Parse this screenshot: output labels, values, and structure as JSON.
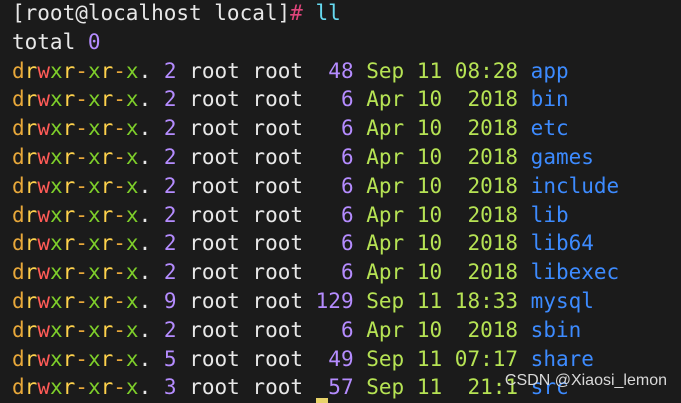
{
  "prompt": {
    "user_host": "[root@localhost local]",
    "symbol": "#",
    "command": "ll"
  },
  "total_line": "total 0",
  "entries": [
    {
      "perms": "drwxr-xr-x.",
      "links": "2",
      "owner": "root",
      "group": "root",
      "size": "48",
      "month": "Sep",
      "day": "11",
      "time": "08:28",
      "name": "app"
    },
    {
      "perms": "drwxr-xr-x.",
      "links": "2",
      "owner": "root",
      "group": "root",
      "size": "6",
      "month": "Apr",
      "day": "10",
      "time": "2018",
      "name": "bin"
    },
    {
      "perms": "drwxr-xr-x.",
      "links": "2",
      "owner": "root",
      "group": "root",
      "size": "6",
      "month": "Apr",
      "day": "10",
      "time": "2018",
      "name": "etc"
    },
    {
      "perms": "drwxr-xr-x.",
      "links": "2",
      "owner": "root",
      "group": "root",
      "size": "6",
      "month": "Apr",
      "day": "10",
      "time": "2018",
      "name": "games"
    },
    {
      "perms": "drwxr-xr-x.",
      "links": "2",
      "owner": "root",
      "group": "root",
      "size": "6",
      "month": "Apr",
      "day": "10",
      "time": "2018",
      "name": "include"
    },
    {
      "perms": "drwxr-xr-x.",
      "links": "2",
      "owner": "root",
      "group": "root",
      "size": "6",
      "month": "Apr",
      "day": "10",
      "time": "2018",
      "name": "lib"
    },
    {
      "perms": "drwxr-xr-x.",
      "links": "2",
      "owner": "root",
      "group": "root",
      "size": "6",
      "month": "Apr",
      "day": "10",
      "time": "2018",
      "name": "lib64"
    },
    {
      "perms": "drwxr-xr-x.",
      "links": "2",
      "owner": "root",
      "group": "root",
      "size": "6",
      "month": "Apr",
      "day": "10",
      "time": "2018",
      "name": "libexec"
    },
    {
      "perms": "drwxr-xr-x.",
      "links": "9",
      "owner": "root",
      "group": "root",
      "size": "129",
      "month": "Sep",
      "day": "11",
      "time": "18:33",
      "name": "mysql"
    },
    {
      "perms": "drwxr-xr-x.",
      "links": "2",
      "owner": "root",
      "group": "root",
      "size": "6",
      "month": "Apr",
      "day": "10",
      "time": "2018",
      "name": "sbin"
    },
    {
      "perms": "drwxr-xr-x.",
      "links": "5",
      "owner": "root",
      "group": "root",
      "size": "49",
      "month": "Sep",
      "day": "11",
      "time": "07:17",
      "name": "share"
    },
    {
      "perms": "drwxr-xr-x.",
      "links": "3",
      "owner": "root",
      "group": "root",
      "size": "57",
      "month": "Sep",
      "day": "11",
      "time": "21:1",
      "name": "src"
    }
  ],
  "watermark": "CSDN @Xiaosi_lemon",
  "colors": {
    "background": "#1b1b1b",
    "text": "#e8e8e8",
    "prompt_symbol": "#e0457b",
    "command": "#66d9ef",
    "perm_dir": "#e8a83a",
    "perm_r": "#ffd24c",
    "perm_w": "#ff5b57",
    "perm_x": "#7ecf2a",
    "perm_dash": "#e8a83a",
    "links": "#b58cff",
    "zero": "#b58cff",
    "size": "#b58cff",
    "date": "#b6e354",
    "dirname": "#3d8bff"
  }
}
